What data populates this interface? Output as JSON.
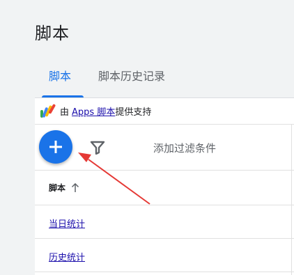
{
  "page": {
    "title": "脚本"
  },
  "tabs": [
    {
      "label": "脚本",
      "active": true
    },
    {
      "label": "脚本历史记录",
      "active": false
    }
  ],
  "powered_by": {
    "prefix": "由",
    "link": "Apps 脚本",
    "suffix": "提供支持"
  },
  "toolbar": {
    "add_icon": "plus-icon",
    "filter_icon": "filter-icon",
    "filter_label": "添加过滤条件"
  },
  "table": {
    "column_header": "脚本",
    "sort_icon": "arrow-up-icon",
    "rows": [
      {
        "name": "当日统计"
      },
      {
        "name": "历史统计"
      }
    ]
  },
  "colors": {
    "accent": "#1a73e8",
    "annotation_arrow": "#e53935",
    "link": "#1a0dab"
  }
}
